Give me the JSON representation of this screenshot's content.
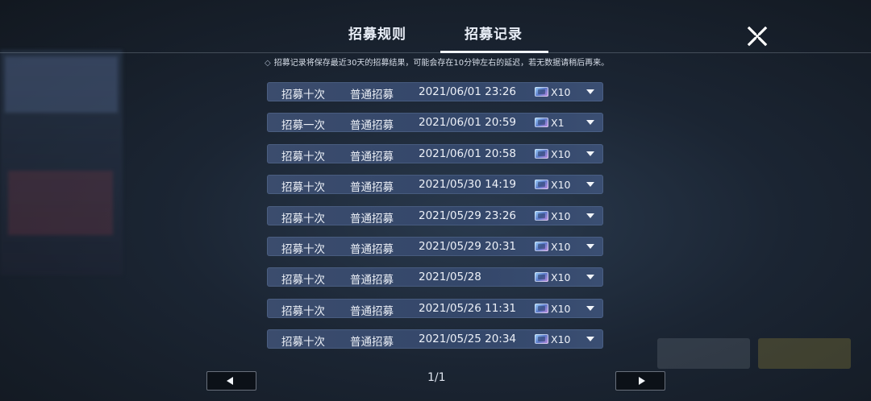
{
  "tabs": {
    "rules": "招募规则",
    "records": "招募记录",
    "active": "records"
  },
  "notice": "招募记录将保存最近30天的招募结果，可能会存在10分钟左右的延迟，若无数据请稍后再来。",
  "notice_icon": "diamond-icon",
  "records": [
    {
      "times": "招募十次",
      "type": "普通招募",
      "datetime": "2021/06/01 23:26",
      "qty": "X10"
    },
    {
      "times": "招募一次",
      "type": "普通招募",
      "datetime": "2021/06/01 20:59",
      "qty": "X1"
    },
    {
      "times": "招募十次",
      "type": "普通招募",
      "datetime": "2021/06/01 20:58",
      "qty": "X10"
    },
    {
      "times": "招募十次",
      "type": "普通招募",
      "datetime": "2021/05/30 14:19",
      "qty": "X10"
    },
    {
      "times": "招募十次",
      "type": "普通招募",
      "datetime": "2021/05/29 23:26",
      "qty": "X10"
    },
    {
      "times": "招募十次",
      "type": "普通招募",
      "datetime": "2021/05/29 20:31",
      "qty": "X10"
    },
    {
      "times": "招募十次",
      "type": "普通招募",
      "datetime": "2021/05/28",
      "qty": "X10"
    },
    {
      "times": "招募十次",
      "type": "普通招募",
      "datetime": "2021/05/26 11:31",
      "qty": "X10"
    },
    {
      "times": "招募十次",
      "type": "普通招募",
      "datetime": "2021/05/25 20:34",
      "qty": "X10"
    }
  ],
  "pagination": {
    "label": "1/1"
  },
  "icons": {
    "close": "close-icon",
    "ticket": "ticket-icon",
    "expand": "chevron-down-icon",
    "prev": "prev-arrow-icon",
    "next": "next-arrow-icon"
  },
  "colors": {
    "row_bg": "#37496b",
    "text": "#edf1f8",
    "background": "#1b2533"
  }
}
